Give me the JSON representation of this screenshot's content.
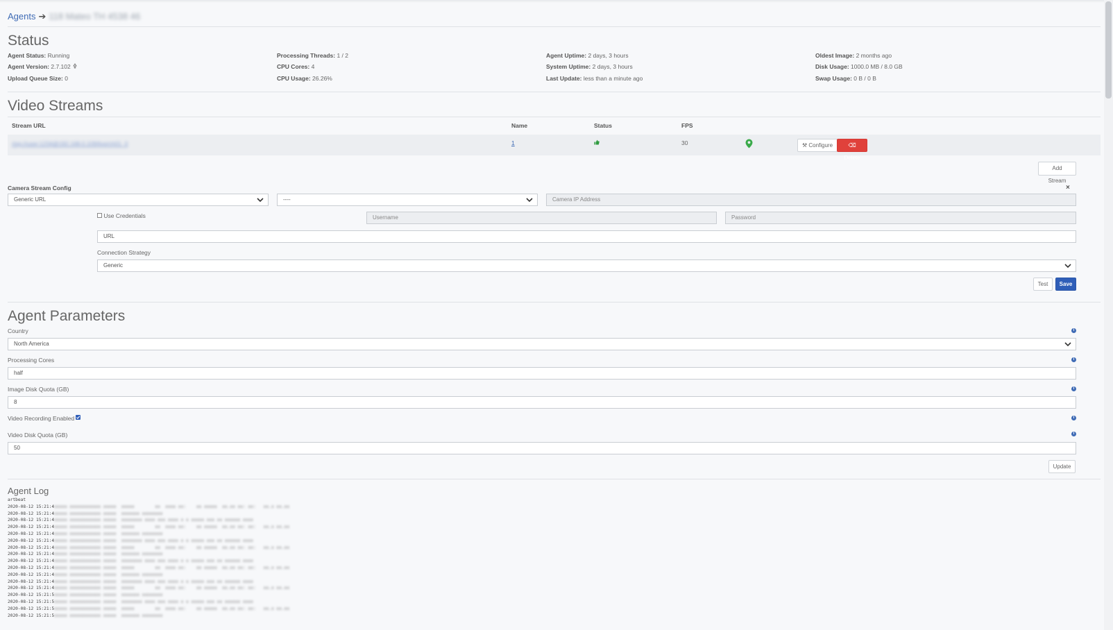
{
  "breadcrumb": {
    "root": "Agents",
    "arrow": "➔",
    "current": "118 Mateo TH 4538 46"
  },
  "status": {
    "title": "Status",
    "col1": [
      {
        "key": "Agent Status:",
        "value": "Running"
      },
      {
        "key": "Agent Version:",
        "value": "2.7.102"
      },
      {
        "key": "Upload Queue Size:",
        "value": "0"
      }
    ],
    "col2": [
      {
        "key": "Processing Threads:",
        "value": "1 / 2"
      },
      {
        "key": "CPU Cores:",
        "value": "4"
      },
      {
        "key": "CPU Usage:",
        "value": "26.26%"
      }
    ],
    "col3": [
      {
        "key": "Agent Uptime:",
        "value": "2 days, 3 hours"
      },
      {
        "key": "System Uptime:",
        "value": "2 days, 3 hours"
      },
      {
        "key": "Last Update:",
        "value": "less than a minute ago"
      }
    ],
    "col4": [
      {
        "key": "Oldest Image:",
        "value": "2 months ago"
      },
      {
        "key": "Disk Usage:",
        "value": "1000.0 MB / 8.0 GB"
      },
      {
        "key": "Swap Usage:",
        "value": "0 B / 0 B"
      }
    ]
  },
  "video_streams": {
    "title": "Video Streams",
    "headers": {
      "url": "Stream URL",
      "name": "Name",
      "status": "Status",
      "fps": "FPS"
    },
    "row": {
      "url": "rtsp://user:1234@192.168.0.109/live/ch01_0",
      "name": "1",
      "fps": "30"
    },
    "configure_label": "Configure",
    "delete_label": "Delete",
    "add_stream_label": "Add Stream"
  },
  "camera_config": {
    "title": "Camera Stream Config",
    "type_value": "Generic URL",
    "model_value": "----",
    "ip_placeholder": "Camera IP Address",
    "use_credentials_label": "Use Credentials",
    "username_placeholder": "Username",
    "password_placeholder": "Password",
    "url_placeholder": "URL",
    "strategy_label": "Connection Strategy",
    "strategy_value": "Generic",
    "test_label": "Test",
    "save_label": "Save"
  },
  "agent_params": {
    "title": "Agent Parameters",
    "country_label": "Country",
    "country_value": "North America",
    "cores_label": "Processing Cores",
    "cores_value": "half",
    "image_quota_label": "Image Disk Quota (GB)",
    "image_quota_value": "8",
    "video_rec_label": "Video Recording Enabled",
    "video_quota_label": "Video Disk Quota (GB)",
    "video_quota_value": "50",
    "update_label": "Update",
    "info_glyph": "i"
  },
  "agent_log": {
    "title": "Agent Log",
    "first_line": "artbeat",
    "lines": [
      "2020-08-12 15:21:4",
      "2020-08-12 15:21:4",
      "2020-08-12 15:21:4",
      "2020-08-12 15:21:4",
      "2020-08-12 15:21:4",
      "2020-08-12 15:21:4",
      "2020-08-12 15:21:4",
      "2020-08-12 15:21:4",
      "2020-08-12 15:21:4",
      "2020-08-12 15:21:4",
      "2020-08-12 15:21:4",
      "2020-08-12 15:21:4",
      "2020-08-12 15:21:4",
      "2020-08-12 15:21:5",
      "2020-08-12 15:21:5",
      "2020-08-12 15:21:5",
      "2020-08-12 15:21:5"
    ],
    "redacted_tail": "redacted log output"
  },
  "colors": {
    "link": "#3f6bb5",
    "danger": "#e0413b",
    "primary": "#2f5eb8",
    "ok": "#2e9a3e"
  }
}
